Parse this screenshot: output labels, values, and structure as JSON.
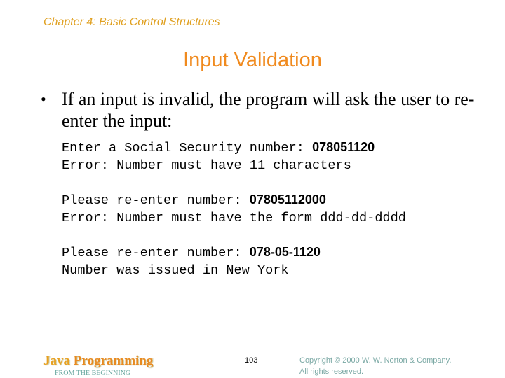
{
  "header": {
    "chapter": "Chapter 4: Basic Control Structures",
    "title": "Input Validation"
  },
  "body": {
    "bullet_symbol": "•",
    "bullet_text": "If an input is invalid, the program will ask the user to re-enter the input:",
    "console": [
      {
        "prompt": "Enter a Social Security number: ",
        "input": "078051120",
        "response": "Error: Number must have 11 characters"
      },
      {
        "prompt": "Please re-enter number: ",
        "input": "07805112000",
        "response": "Error: Number must have the form ddd-dd-dddd"
      },
      {
        "prompt": "Please re-enter number: ",
        "input": "078-05-1120",
        "response": "Number was issued in New York"
      }
    ]
  },
  "footer": {
    "book_title_part1": "Java",
    "book_title_part2": " Programming",
    "book_subtitle": "FROM THE BEGINNING",
    "page_number": "103",
    "copyright_line1": "Copyright © 2000 W. W. Norton & Company.",
    "copyright_line2": "All rights reserved."
  },
  "colors": {
    "chapter": "#e0a020",
    "title": "#f08a1e",
    "copyright": "#7aa8a4"
  }
}
